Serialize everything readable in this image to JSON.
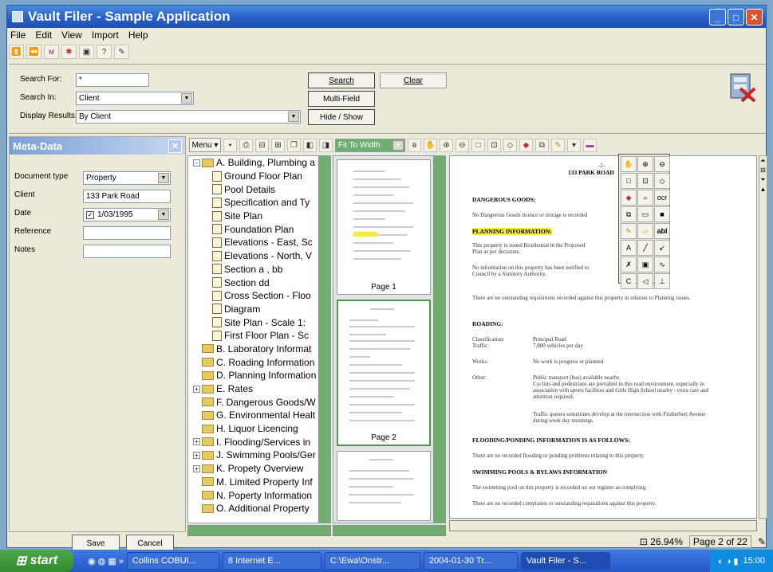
{
  "window": {
    "title": "Vault Filer - Sample Application"
  },
  "menu": [
    "File",
    "Edit",
    "View",
    "Import",
    "Help"
  ],
  "search": {
    "search_for_label": "Search For:",
    "search_for_value": "*",
    "search_in_label": "Search In:",
    "search_in_value": "Client",
    "display_results_label": "Display Results:",
    "display_results_value": "By Client",
    "search_button": "Search",
    "clear_button": "Clear",
    "multifield_button": "Multi-Field",
    "hide_show_button": "Hide / Show"
  },
  "meta": {
    "title": "Meta-Data",
    "document_type_label": "Document type",
    "document_type_value": "Property",
    "client_label": "Client",
    "client_value": "133 Park Road",
    "date_label": "Date",
    "date_value": "1/03/1995",
    "reference_label": "Reference",
    "notes_label": "Notes",
    "save_button": "Save",
    "cancel_button": "Cancel"
  },
  "viewer_toolbar": {
    "menu_label": "Menu",
    "zoom_select": "Fit To Width"
  },
  "tree": [
    {
      "label": "A. Building, Plumbing a",
      "type": "folder",
      "level": 0,
      "expander": "-"
    },
    {
      "label": "Ground Floor Plan",
      "type": "doc",
      "level": 1
    },
    {
      "label": "Pool Details",
      "type": "doc",
      "level": 1
    },
    {
      "label": "Specification and Ty",
      "type": "doc",
      "level": 1
    },
    {
      "label": "Site Plan",
      "type": "doc",
      "level": 1
    },
    {
      "label": "Foundation Plan",
      "type": "doc",
      "level": 1
    },
    {
      "label": "Elevations - East, Sc",
      "type": "doc",
      "level": 1
    },
    {
      "label": "Elevations - North, V",
      "type": "doc",
      "level": 1
    },
    {
      "label": "Section a , bb",
      "type": "doc",
      "level": 1
    },
    {
      "label": "Section dd",
      "type": "doc",
      "level": 1
    },
    {
      "label": "Cross Section - Floo",
      "type": "doc",
      "level": 1
    },
    {
      "label": "Diagram",
      "type": "doc",
      "level": 1
    },
    {
      "label": "Site Plan - Scale 1:",
      "type": "doc",
      "level": 1
    },
    {
      "label": "First Floor Plan - Sc",
      "type": "doc",
      "level": 1
    },
    {
      "label": "B. Laboratory Informat",
      "type": "folder",
      "level": 0
    },
    {
      "label": "C. Roading Information",
      "type": "folder",
      "level": 0
    },
    {
      "label": "D. Planning Information",
      "type": "folder",
      "level": 0
    },
    {
      "label": "E. Rates",
      "type": "folder",
      "level": 0,
      "expander": "+"
    },
    {
      "label": "F. Dangerous Goods/W",
      "type": "folder",
      "level": 0
    },
    {
      "label": "G. Environmental Healt",
      "type": "folder",
      "level": 0
    },
    {
      "label": "H. Liquor Licencing",
      "type": "folder",
      "level": 0
    },
    {
      "label": "I. Flooding/Services in",
      "type": "folder",
      "level": 0,
      "expander": "+"
    },
    {
      "label": "J. Swimming Pools/Ger",
      "type": "folder",
      "level": 0,
      "expander": "+"
    },
    {
      "label": "K. Propety Overview",
      "type": "folder",
      "level": 0,
      "expander": "+"
    },
    {
      "label": "M. Limited Property Inf",
      "type": "folder",
      "level": 0
    },
    {
      "label": "N. Poperty Information",
      "type": "folder",
      "level": 0
    },
    {
      "label": "O. Additional Property",
      "type": "folder",
      "level": 0
    }
  ],
  "thumbnails": [
    "Page 1",
    "Page 2"
  ],
  "document": {
    "page_num": "-2-",
    "address": "133 PARK ROAD",
    "h_dangerous": "DANGEROUS GOODS:",
    "p_dangerous": "No Dangerous Goods licence or storage is recorded",
    "h_planning": "PLANNING INFORMATION:",
    "p_planning1": "This property is zoned Residential in the Proposed",
    "p_planning1b": "Plan as per decisions.",
    "p_planning2": "No information on this property has been notified to",
    "p_planning2b": "Council by a Statutory Authority.",
    "p_requisitions": "There are no outstanding requisitions recorded against this property in relation to Planning issues.",
    "h_roading": "ROADING:",
    "classification_label": "Classification:",
    "classification_value": "Principal Road",
    "traffic_label": "Traffic:",
    "traffic_value": "7,800 vehicles per day",
    "works_label": "Works:",
    "works_value": "No work is progress or planned.",
    "other_label": "Other:",
    "other_value1": "Public transport (bus) available nearby.",
    "other_value2": "Cyclists and pedestrians are prevalent in this road environment, especially in association with sports facilities and Girls High School nearby - extra care and attention required.",
    "other_value3": "Traffic queues sometimes develop at the intersection with Fitzherbert Avenue during week day mornings.",
    "h_flooding": "FLOODING/PONDING INFORMATION IS AS FOLLOWS:",
    "p_flooding": "There are no recorded flooding or ponding problems relating to this property.",
    "h_swimming": "SWIMMING POOLS & BYLAWS INFORMATION",
    "p_swimming1": "The swimming pool on this property is recorded on our register as complying.",
    "p_swimming2": "There are no recorded complaints or outstanding requisitions against this property."
  },
  "palette": {
    "text_tool": "abl",
    "ocr_tool": "ocr"
  },
  "status": {
    "zoom": "26.94%",
    "page": "Page 2 of 22"
  },
  "taskbar": {
    "start": "start",
    "tasks": [
      "Collins COBUI...",
      "8 Internet E...",
      "C:\\Ewa\\Onstr...",
      "2004-01-30 Tr...",
      "Vault Filer - S..."
    ],
    "clock": "15:00"
  }
}
